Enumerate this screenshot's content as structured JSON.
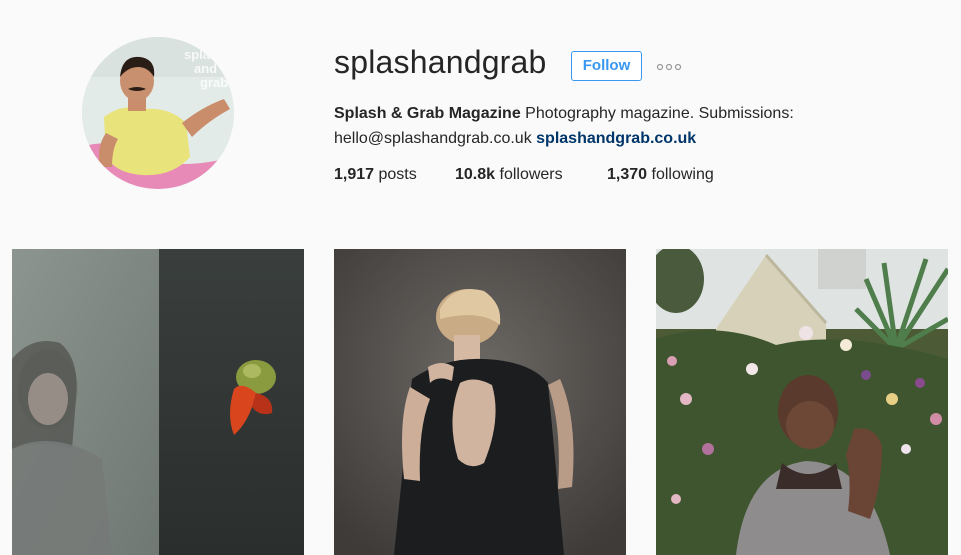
{
  "profile": {
    "username": "splashandgrab",
    "follow_label": "Follow",
    "full_name": "Splash & Grab Magazine",
    "bio_text": "Photography magazine. Submissions: hello@splashandgrab.co.uk",
    "website": "splashandgrab.co.uk",
    "avatar_overlay_text": "splash and grab"
  },
  "stats": {
    "posts_count": "1,917",
    "posts_label": "posts",
    "followers_count": "10.8k",
    "followers_label": "followers",
    "following_count": "1,370",
    "following_label": "following"
  },
  "colors": {
    "accent": "#3897f0",
    "link": "#003569",
    "background": "#fafafa"
  },
  "icons": {
    "more": "more-options-icon"
  }
}
